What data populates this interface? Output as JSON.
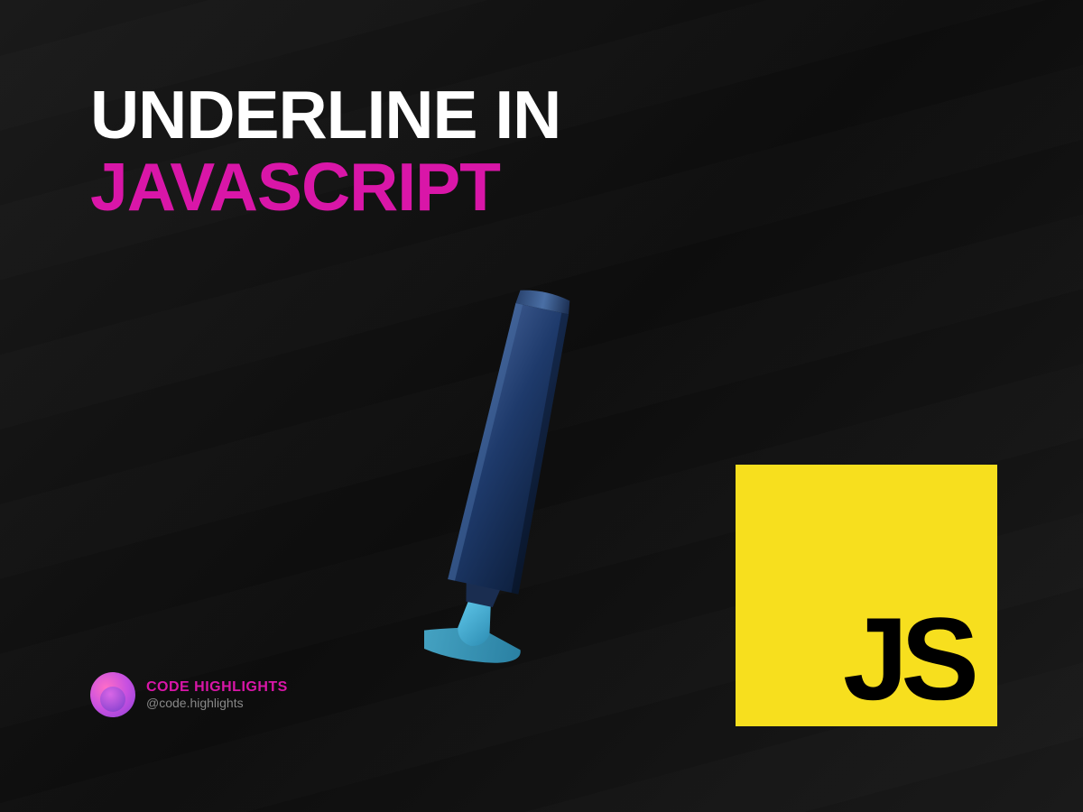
{
  "heading": {
    "line1": "UNDERLINE IN",
    "line2": "JAVASCRIPT"
  },
  "jsLogo": {
    "text": "JS"
  },
  "brand": {
    "name": "CODE HIGHLIGHTS",
    "handle": "@code.highlights"
  },
  "colors": {
    "accent": "#d916a8",
    "jsYellow": "#f7df1e",
    "background": "#121212"
  }
}
